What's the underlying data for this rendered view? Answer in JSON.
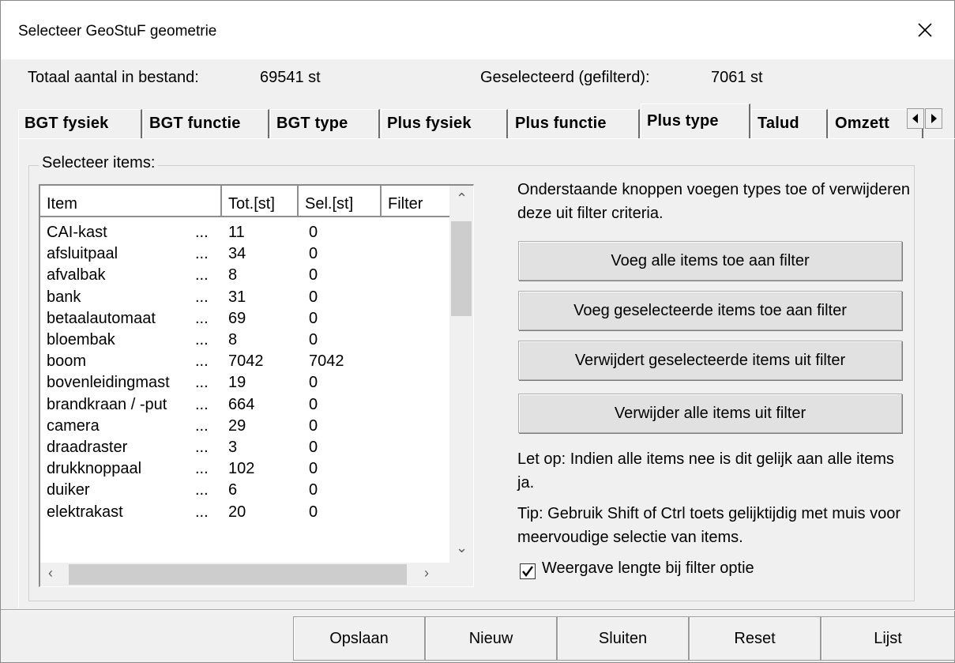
{
  "window": {
    "title": "Selecteer GeoStuF geometrie"
  },
  "stats": {
    "total_label": "Totaal aantal in bestand:",
    "total_value": "69541 st",
    "selected_label": "Geselecteerd (gefilterd):",
    "selected_value": "7061 st"
  },
  "tabs": [
    {
      "label": "BGT fysiek",
      "active": false
    },
    {
      "label": "BGT functie",
      "active": false
    },
    {
      "label": "BGT type",
      "active": false
    },
    {
      "label": "Plus fysiek",
      "active": false
    },
    {
      "label": "Plus functie",
      "active": false
    },
    {
      "label": "Plus type",
      "active": true
    },
    {
      "label": "Talud",
      "active": false
    },
    {
      "label": "Omzett",
      "active": false
    }
  ],
  "group": {
    "caption": "Selecteer items:"
  },
  "list": {
    "columns": [
      "Item",
      "Tot.[st]",
      "Sel.[st]",
      "Filter"
    ],
    "rows": [
      {
        "item": "CAI-kast",
        "dots": "...",
        "tot": "11",
        "sel": "0"
      },
      {
        "item": "afsluitpaal",
        "dots": "...",
        "tot": "34",
        "sel": "0"
      },
      {
        "item": "afvalbak",
        "dots": "...",
        "tot": "8",
        "sel": "0"
      },
      {
        "item": "bank",
        "dots": "...",
        "tot": "31",
        "sel": "0"
      },
      {
        "item": "betaalautomaat",
        "dots": "...",
        "tot": "69",
        "sel": "0"
      },
      {
        "item": "bloembak",
        "dots": "...",
        "tot": "8",
        "sel": "0"
      },
      {
        "item": "boom",
        "dots": "...",
        "tot": "7042",
        "sel": "7042"
      },
      {
        "item": "bovenleidingmast",
        "dots": "...",
        "tot": "19",
        "sel": "0"
      },
      {
        "item": "brandkraan / -put",
        "dots": "...",
        "tot": "664",
        "sel": "0"
      },
      {
        "item": "camera",
        "dots": "...",
        "tot": "29",
        "sel": "0"
      },
      {
        "item": "draadraster",
        "dots": "...",
        "tot": "3",
        "sel": "0"
      },
      {
        "item": "drukknoppaal",
        "dots": "...",
        "tot": "102",
        "sel": "0"
      },
      {
        "item": "duiker",
        "dots": "...",
        "tot": "6",
        "sel": "0"
      },
      {
        "item": "elektrakast",
        "dots": "...",
        "tot": "20",
        "sel": "0"
      }
    ]
  },
  "help": {
    "intro": "Onderstaande knoppen voegen types toe of verwijderen deze uit filter criteria.",
    "note": "Let op: Indien alle items nee is dit gelijk aan alle items ja.",
    "tip": "Tip: Gebruik Shift of Ctrl toets gelijktijdig met muis voor meervoudige selectie van items."
  },
  "actions": {
    "add_all": "Voeg alle items toe aan filter",
    "add_selected": "Voeg geselecteerde items toe aan filter",
    "remove_selected": "Verwijdert geselecteerde items uit filter",
    "remove_all": "Verwijder alle items uit filter"
  },
  "option": {
    "label": "Weergave lengte bij filter optie",
    "checked": true
  },
  "footer": {
    "save": "Opslaan",
    "new": "Nieuw",
    "close": "Sluiten",
    "reset": "Reset",
    "list": "Lijst"
  }
}
